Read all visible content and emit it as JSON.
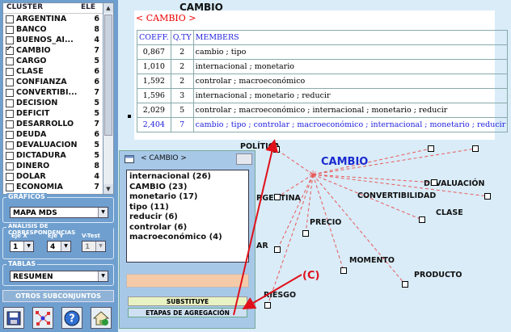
{
  "left_panel": {
    "header": {
      "cluster": "CLUSTER",
      "ele": "ELE"
    },
    "clusters": [
      {
        "label": "ARGENTINA",
        "count": "6",
        "checked": false
      },
      {
        "label": "BANCO",
        "count": "8",
        "checked": false
      },
      {
        "label": "BUENOS_AI...",
        "count": "4",
        "checked": false
      },
      {
        "label": "CAMBIO",
        "count": "7",
        "checked": true
      },
      {
        "label": "CARGO",
        "count": "5",
        "checked": false
      },
      {
        "label": "CLASE",
        "count": "6",
        "checked": false
      },
      {
        "label": "CONFIANZA",
        "count": "6",
        "checked": false
      },
      {
        "label": "CONVERTIBI...",
        "count": "7",
        "checked": false
      },
      {
        "label": "DECISIÓN",
        "count": "5",
        "checked": false
      },
      {
        "label": "DÉFICIT",
        "count": "5",
        "checked": false
      },
      {
        "label": "DESARROLLO",
        "count": "7",
        "checked": false
      },
      {
        "label": "DEUDA",
        "count": "6",
        "checked": false
      },
      {
        "label": "DEVALUACIÓN",
        "count": "5",
        "checked": false
      },
      {
        "label": "DICTADURA",
        "count": "5",
        "checked": false
      },
      {
        "label": "DINERO",
        "count": "8",
        "checked": false
      },
      {
        "label": "DÓLAR",
        "count": "4",
        "checked": false
      },
      {
        "label": "ECONOMÍA",
        "count": "7",
        "checked": false
      }
    ],
    "graficos": {
      "title": "GRÁFICOS",
      "value": "MAPA MDS"
    },
    "correspondencias": {
      "title": "ANÁLISIS DE CORRESPONDENCIAS",
      "eje_x_label": "Eje X",
      "eje_y_label": "Eje Y",
      "vtest_label": "V-Test",
      "eje_x": "1",
      "eje_y": "4",
      "vtest": "1"
    },
    "tablas": {
      "title": "TABLAS",
      "value": "RESUMEN"
    },
    "otros": "OTROS SUBCONJUNTOS"
  },
  "main": {
    "title": "CAMBIO",
    "tag": "< CAMBIO >",
    "table": {
      "headers": [
        "COEFF.",
        "Q.TY",
        "MEMBERS"
      ],
      "rows": [
        [
          "0,867",
          "2",
          "cambio ; tipo"
        ],
        [
          "1,010",
          "2",
          "internacional ; monetario"
        ],
        [
          "1,592",
          "2",
          "controlar ; macroeconómico"
        ],
        [
          "1,596",
          "3",
          "internacional ; monetario ; reducir"
        ],
        [
          "2,029",
          "5",
          "controlar ; macroeconómico ; internacional ; monetario ; reducir"
        ],
        [
          "2,404",
          "7",
          "cambio ; tipo ; controlar ; macroeconómico ; internacional ; monetario ; reducir"
        ]
      ]
    },
    "map": {
      "center": "CAMBIO",
      "nodes": [
        "POLÍTICA",
        "DEVALUACIÓN",
        "CONVERTIBILIDAD",
        "RGENTINA",
        "CLASE",
        "PRECIO",
        "AR",
        "MOMENTO",
        "PRODUCTO",
        "RIESGO"
      ],
      "annotation": "(C)"
    },
    "colors": {
      "center": "#1a2ad0",
      "lines": "#e85a5a",
      "arrow": "#e0101a"
    }
  },
  "popup": {
    "title": "< CAMBIO >",
    "items": [
      "internacional (26)",
      "CAMBIO (23)",
      "monetario (17)",
      "tipo (11)",
      "reducir (6)",
      "controlar (6)",
      "macroeconómico (4)"
    ],
    "substituye": "SUBSTITUYE",
    "etapas": "ETAPAS DE AGREGACIÓN"
  }
}
